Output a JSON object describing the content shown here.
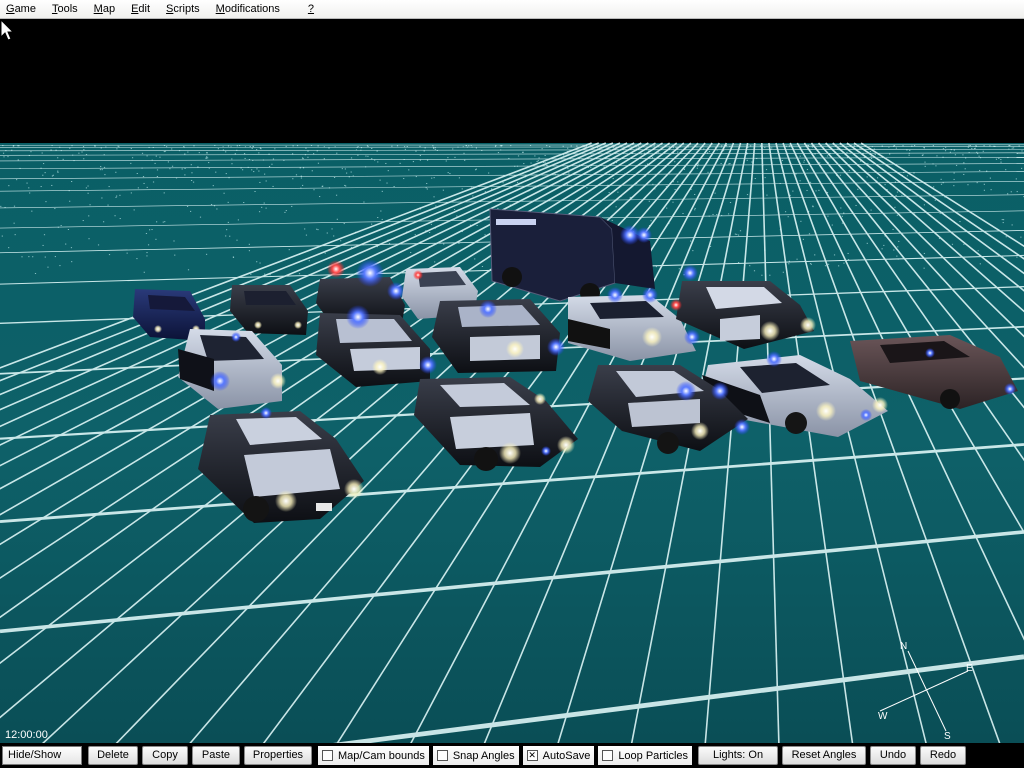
{
  "menu": [
    "Game",
    "Tools",
    "Map",
    "Edit",
    "Scripts",
    "Modifications",
    "?"
  ],
  "menu_underline": [
    "G",
    "T",
    "M",
    "E",
    "S",
    "M",
    "?"
  ],
  "viewport": {
    "clock": "12:00:00",
    "compass": {
      "n": "N",
      "e": "E",
      "s": "S",
      "w": "W"
    },
    "background_color": "#000000",
    "floor_color": "#0b5a5e",
    "grid_color": "#e8ffff"
  },
  "toolbar": {
    "hide_show": "Hide/Show",
    "delete": "Delete",
    "copy": "Copy",
    "paste": "Paste",
    "properties": "Properties",
    "map_cam_bounds": "Map/Cam bounds",
    "snap_angles": "Snap Angles",
    "autosave": "AutoSave",
    "loop_particles": "Loop Particles",
    "lights": "Lights: On",
    "reset_angles": "Reset Angles",
    "undo": "Undo",
    "redo": "Redo"
  },
  "checkboxes": {
    "map_cam_bounds": false,
    "snap_angles": false,
    "autosave": true,
    "loop_particles": false
  }
}
